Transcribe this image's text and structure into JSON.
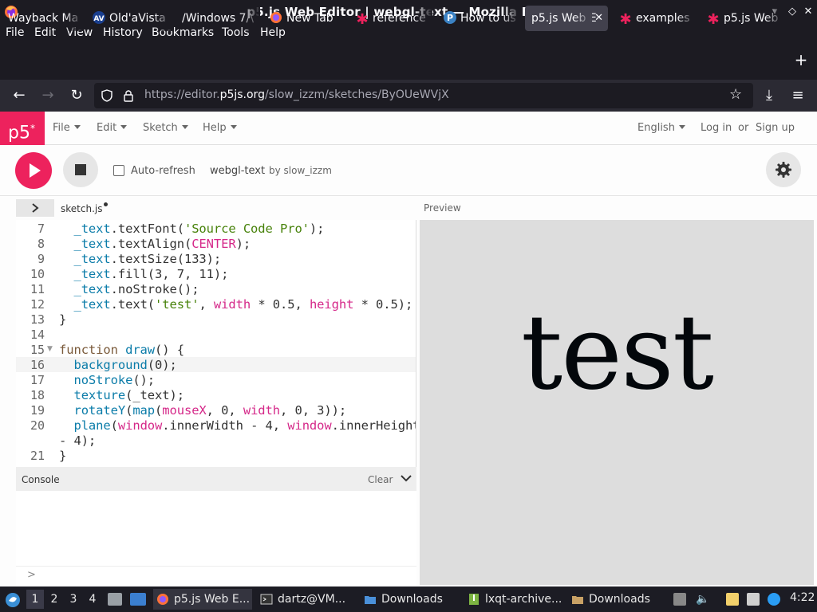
{
  "window": {
    "title": "p5.js Web Editor | webgl-text — Mozilla Firefox"
  },
  "menubar": [
    "File",
    "Edit",
    "View",
    "History",
    "Bookmarks",
    "Tools",
    "Help"
  ],
  "tabs": [
    {
      "label": "Wayback Ma",
      "icon": "none"
    },
    {
      "label": "Old'aVista",
      "icon": "av-icon"
    },
    {
      "label": "/Windows 7/\\",
      "icon": "none"
    },
    {
      "label": "New Tab",
      "icon": "firefox-icon"
    },
    {
      "label": "reference",
      "icon": "p5-star-icon"
    },
    {
      "label": "How to us",
      "icon": "p-icon"
    },
    {
      "label": "p5.js Web E",
      "icon": "none"
    },
    {
      "label": "examples",
      "icon": "p5-star-icon"
    },
    {
      "label": "p5.js Web",
      "icon": "p5-star-icon"
    }
  ],
  "url": {
    "prefix": "https://editor.",
    "domain": "p5js.org",
    "path": "/slow_izzm/sketches/ByOUeWVjX"
  },
  "p5": {
    "logo": "p5",
    "logo_sup": "*",
    "menu": [
      "File",
      "Edit",
      "Sketch",
      "Help"
    ],
    "language": "English",
    "login": "Log in",
    "or": "or",
    "signup": "Sign up",
    "auto_refresh": "Auto-refresh",
    "sketch_name": "webgl-text",
    "by": "by slow_izzm",
    "file_tab": "sketch.js",
    "preview_label": "Preview",
    "console_label": "Console",
    "clear_label": "Clear",
    "prompt": ">",
    "preview_text": "test"
  },
  "code": {
    "line_numbers": [
      "7",
      "8",
      "9",
      "10",
      "11",
      "12",
      "13",
      "14",
      "15",
      "16",
      "17",
      "18",
      "19",
      "20",
      "21"
    ]
  },
  "taskbar": {
    "workspaces": [
      "1",
      "2",
      "3",
      "4"
    ],
    "items": [
      "p5.js Web E...",
      "dartz@VM...",
      "Downloads",
      "lxqt-archive...",
      "Downloads"
    ],
    "clock": "4:22"
  }
}
